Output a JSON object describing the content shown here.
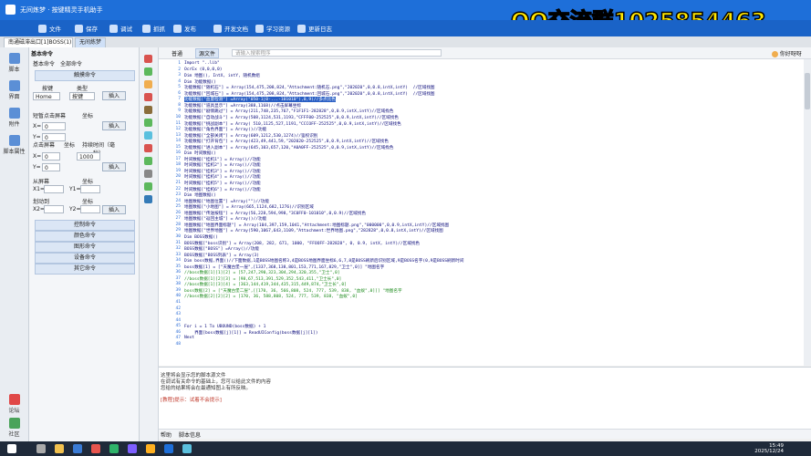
{
  "app": {
    "title": "无间炼梦 · 按键精灵手机助手",
    "watermark": "QQ交流群1025854463"
  },
  "toolbar": {
    "file": "文件",
    "save": "保存",
    "debug": "调试",
    "capture": "抓抓",
    "publish": "发布",
    "dev_docs": "开发文档",
    "learn": "学习资源",
    "history": "更新日志"
  },
  "tabs": [
    "南通磁滞出口[1]BOSS(1)",
    "无间炼梦"
  ],
  "rail": {
    "script": "脚本",
    "ui": "界面",
    "attach": "附件",
    "props": "脚本属性",
    "forum": "论坛",
    "community": "社区"
  },
  "cmd": {
    "header": "基本命令",
    "tab_basic": "基本命令",
    "tab_all": "全部命令",
    "touch": "触摸命令",
    "key_lbl": "按键",
    "type_lbl": "类型",
    "key_val": "Home",
    "type_val": "按键",
    "insert": "插入",
    "tap_lbl": "短暂点击屏幕",
    "coord": "坐标",
    "x": "X=",
    "y": "Y=",
    "x_val": "0",
    "y_val": "0",
    "press_lbl": "点击屏幕",
    "hold_lbl": "持续时间（毫秒）",
    "hold_val": "1000",
    "swipe_lbl": "从屏幕",
    "x1": "X1=",
    "y1": "Y1=",
    "slide_lbl": "划动到",
    "x2": "X2=",
    "y2": "Y2=",
    "sections": [
      "控制命令",
      "颜色命令",
      "图形命令",
      "设备命令",
      "其它命令"
    ]
  },
  "editor": {
    "tab_src": "普通",
    "tab_ui": "源文件",
    "search_placeholder": "请输入搜索程序",
    "assistant": "你好呀呀"
  },
  "code_lines": [
    {
      "n": "1",
      "t": "Import \"..lib\"",
      "k": "n"
    },
    {
      "n": "2",
      "t": "OcrEx (0,0,0,0)",
      "k": "n"
    },
    {
      "n": "3",
      "t": "Dim 地图(), IntX, intY, 随机数组",
      "k": "n"
    },
    {
      "n": "4",
      "t": "Dim 功能数据()",
      "k": "n"
    },
    {
      "n": "5",
      "t": "功能数据[\"随机石\"] = Array(154,475,208,824,\"Attachment:随机石.png\",\"202020\",0,0.8,intX,intY)  //区域找图",
      "k": "n"
    },
    {
      "n": "6",
      "t": "功能数据[\"回城石\"] = Array(154,475,208,824,\"Attachment:回城石.png\",\"202020\",0,0.8,intX,intY)  //区域找图",
      "k": "n"
    },
    {
      "n": "7",
      "t": "功能数据[\"血量检测\"] =Array(\"050-1|0-...-101010\"),0,9)//多点比色",
      "k": "h"
    },
    {
      "n": "8",
      "t": "功能数据[\"道具显示\"] =Array(388,1168)//点击屏幕坐标",
      "k": "n"
    },
    {
      "n": "9",
      "t": "功能数据[\"剧情跳过\"] = Array(211,748,235,767,\"F1F1F1-282828\",0,0.9,intX,intY)//区域找色",
      "k": "n"
    },
    {
      "n": "10",
      "t": "功能数据[\"自动战斗\"] = Array(508,1124,531,1193,\"CFFF00-252525\",0,0.9,intX,intY)//区域找色",
      "k": "n"
    },
    {
      "n": "11",
      "t": "功能数据[\"挑战副本\"] = Array( 510,1125,527,1191,\"CCCOFF-252525\",0,0.9,intX,intY)//区域找色",
      "k": "n"
    },
    {
      "n": "12",
      "t": "功能数据[\"角色界面\"] = Array()//功能",
      "k": "n"
    },
    {
      "n": "13",
      "t": "功能数据[\"全部关闭\"] = Array(609,1212,530,1274)//鉴权识别",
      "k": "n"
    },
    {
      "n": "14",
      "t": "功能数据[\"打开背包\"] = Array(423,49,441,59,\"202020-252525\",0,0.9,intX,intY)//区域找色",
      "k": "n"
    },
    {
      "n": "15",
      "t": "功能数据[\"进入副本\"] = Array(645,103,657,120,\"A0A0FF-252525\",0,0.9,intX,intY)//区域找色",
      "k": "n"
    },
    {
      "n": "16",
      "t": "Dim 时间数据()",
      "k": "n"
    },
    {
      "n": "17",
      "t": "时间数据[\"挂机1\"] = Array()//功能",
      "k": "n"
    },
    {
      "n": "18",
      "t": "时间数据[\"挂机2\"] = Array()//功能",
      "k": "n"
    },
    {
      "n": "19",
      "t": "时间数据[\"挂机3\"] = Array()//功能",
      "k": "n"
    },
    {
      "n": "20",
      "t": "时间数据[\"挂机4\"] = Array()//功能",
      "k": "n"
    },
    {
      "n": "21",
      "t": "时间数据[\"挂机5\"] = Array()//功能",
      "k": "n"
    },
    {
      "n": "22",
      "t": "时间数据[\"挂机6\"] = Array()//功能",
      "k": "n"
    },
    {
      "n": "23",
      "t": "Dim 地图数据()",
      "k": "n"
    },
    {
      "n": "24",
      "t": "地图数据[\"地图位置\"] =Array(\"\")//功能",
      "k": "n"
    },
    {
      "n": "25",
      "t": "地图数据[\"小地图\"] = Array(665,1124,682,1276)//识别区域",
      "k": "n"
    },
    {
      "n": "26",
      "t": "地图数据[\"传送按钮\"] = Array(56,228,594,998,\"3C0FF0-101010\",0,0.9)//区域找色",
      "k": "n"
    },
    {
      "n": "27",
      "t": "地图数据[\"返回主城\"] = Array()//功能",
      "k": "n"
    },
    {
      "n": "28",
      "t": "地图数据[\"地图界面标题\"] = Array(104,397,159,1041,\"Attachment:地图标题.png\",\"000000\",0,0.9,intX,intY)//区域找图",
      "k": "n"
    },
    {
      "n": "29",
      "t": "地图数据[\"世界地图\"] = Array(590,1067,643,1109,\"Attachment:世界地图.png\",\"282828\",0,0.8,intX,intY)//区域找图",
      "k": "n"
    },
    {
      "n": "30",
      "t": "Dim BOSS数据()",
      "k": "n"
    },
    {
      "n": "31",
      "t": "BOSS数据[\"boss识别\"] = Array(208, 282, 671, 1000, \"FFOOFF-282828\", 0, 0.9, intX, intY)//区域找色",
      "k": "n"
    },
    {
      "n": "32",
      "t": "BOSS数据[\"BOSS\"] =Array()//功能",
      "k": "n"
    },
    {
      "n": "33",
      "t": "BOSS数据[\"BOSS列表\"] = Array(3)",
      "k": "n"
    },
    {
      "n": "34",
      "t": "Dim boss数据,界面()//下面数据,1是BOSS地图名称3,4是BOSS地图界面坐标6,6,7,8是BOSS刷新后识别区域,9是BOSS名字(0,9是BOSS刷新时间",
      "k": "n"
    },
    {
      "n": "35",
      "t": "boss数据[1] = [\"天魔古堡一层\",[1337,368,138,801,153,771,167,829,\"卫士\",0]] \"地图名字",
      "k": "n"
    },
    {
      "n": "36",
      "t": "//boss数据[1][1][2] = [57,247,290,323,304,294,320,355,\"卫士\",0]",
      "k": "c"
    },
    {
      "n": "37",
      "t": "//boss数据[1][2][3] = [98,67,513,391,529,352,543,411,\"卫士长\",0]",
      "k": "c"
    },
    {
      "n": "38",
      "t": "//boss数据[1][3][4] = [363,144,419,344,435,315,449,874,\"卫士长\",0]",
      "k": "c"
    },
    {
      "n": "39",
      "t": "boss数据[2] = [\"天魔古堡二层\",[[170, 36, 566,808, 524, 777, 539, 838, \"血蚁\",0]]] \"地图名字",
      "k": "c"
    },
    {
      "n": "40",
      "t": "//boss数据[2][2][2] = [170, 36, 588,808, 524, 777, 539, 838, \"血蚁\",0]",
      "k": "c"
    },
    {
      "n": "41",
      "t": "",
      "k": "n"
    },
    {
      "n": "42",
      "t": "",
      "k": "n"
    },
    {
      "n": "43",
      "t": "",
      "k": "n"
    },
    {
      "n": "44",
      "t": "",
      "k": "n"
    },
    {
      "n": "45",
      "t": "For i = 1 To UBOUND(boss数据) + 1",
      "k": "n"
    },
    {
      "n": "46",
      "t": "    界面[boss数据[j][1]] = ReadUIConfig(boss数据[j][1])",
      "k": "n"
    },
    {
      "n": "47",
      "t": "Next",
      "k": "n"
    },
    {
      "n": "48",
      "t": "",
      "k": "n"
    }
  ],
  "output": {
    "line1": "这里将会显示您的脚本源文件",
    "line2": "在调试有关命令的基础上，您可以给此文件的内容",
    "line3": "您给的结果将会在最通知图上有所反映。",
    "line4": "[教程]提示：试着不会提示]",
    "tab_help": "帮助",
    "tab_info": "脚本信息"
  },
  "taskbar": {
    "time": "15:49",
    "date": "2025/12/24"
  }
}
